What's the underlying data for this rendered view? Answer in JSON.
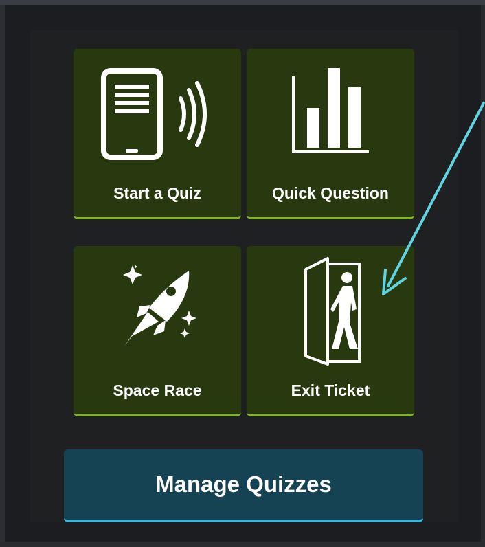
{
  "tiles": {
    "start_quiz": {
      "label": "Start a Quiz",
      "icon": "tablet-signal-icon"
    },
    "quick_question": {
      "label": "Quick Question",
      "icon": "bar-chart-icon"
    },
    "space_race": {
      "label": "Space Race",
      "icon": "rocket-icon"
    },
    "exit_ticket": {
      "label": "Exit Ticket",
      "icon": "exit-door-icon"
    }
  },
  "manage_button": {
    "label": "Manage Quizzes"
  },
  "annotation": {
    "type": "arrow",
    "color": "#5fd3e0"
  },
  "colors": {
    "tile_bg": "#283910",
    "tile_accent": "#7fb32a",
    "manage_bg": "#164354",
    "manage_accent": "#3fb4d9"
  }
}
